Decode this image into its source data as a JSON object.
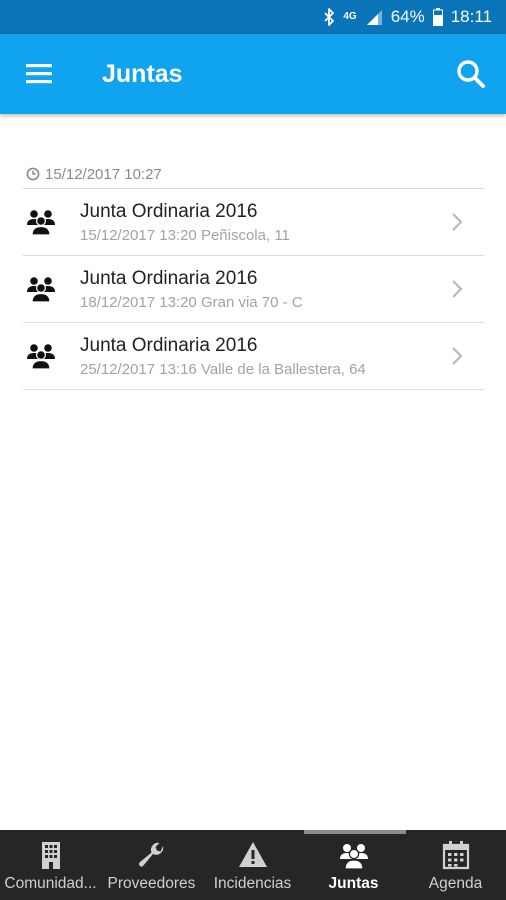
{
  "status_bar": {
    "network": "4G",
    "battery": "64%",
    "time": "18:11"
  },
  "app_bar": {
    "title": "Juntas",
    "menu_icon": "menu-icon",
    "search_icon": "search-icon"
  },
  "section": {
    "date": "15/12/2017 10:27"
  },
  "items": [
    {
      "title": "Junta Ordinaria 2016",
      "subtitle": "15/12/2017 13:20 Peñiscola, 11"
    },
    {
      "title": "Junta Ordinaria 2016",
      "subtitle": "18/12/2017 13:20 Gran via 70 - C"
    },
    {
      "title": "Junta Ordinaria 2016",
      "subtitle": "25/12/2017 13:16 Valle de la Ballestera, 64"
    }
  ],
  "bottom_nav": [
    {
      "label": "Comunidad...",
      "icon": "building-icon"
    },
    {
      "label": "Proveedores",
      "icon": "wrench-icon"
    },
    {
      "label": "Incidencias",
      "icon": "warning-icon"
    },
    {
      "label": "Juntas",
      "icon": "group-icon"
    },
    {
      "label": "Agenda",
      "icon": "calendar-icon"
    }
  ],
  "colors": {
    "status_bar": "#0a74b8",
    "app_bar": "#10a3ef",
    "bottom_nav": "#262626"
  }
}
